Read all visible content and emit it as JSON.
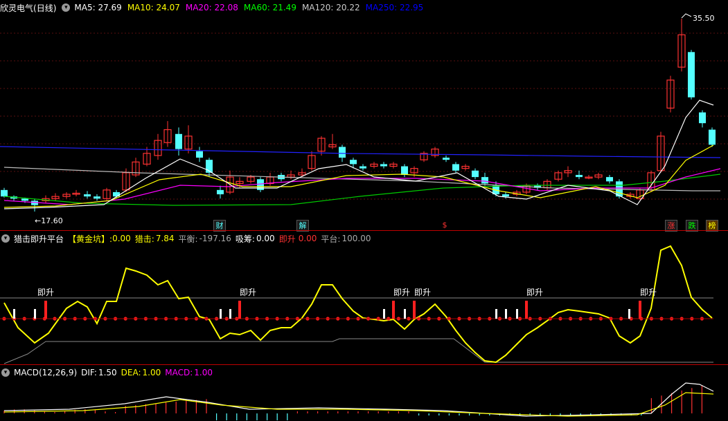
{
  "main_chart": {
    "stock_name": "欣灵电气",
    "period": "(日线)",
    "ma_legend": [
      {
        "label": "MA5:",
        "value": "27.69",
        "color": "#ffffff"
      },
      {
        "label": "MA10:",
        "value": "24.07",
        "color": "#ffff00"
      },
      {
        "label": "MA20:",
        "value": "22.08",
        "color": "#ff00ff"
      },
      {
        "label": "MA60:",
        "value": "21.49",
        "color": "#00ff00"
      },
      {
        "label": "MA120:",
        "value": "20.22",
        "color": "#cccccc"
      },
      {
        "label": "MA250:",
        "value": "22.95",
        "color": "#0000ff"
      }
    ],
    "high_label": "35.50",
    "low_label": "17.60",
    "event_marks": [
      "财",
      "解",
      "$",
      "涨",
      "跌",
      "榜"
    ]
  },
  "indicator_panel": {
    "name": "猎击即升平台",
    "gold_pit_label": "【黄金坑】:",
    "gold_pit_value": "0.00",
    "hunt_label": "猎击:",
    "hunt_value": "7.84",
    "balance_label": "平衡:",
    "balance_value": "-197.16",
    "absorb_label": "吸筹:",
    "absorb_value": "0.00",
    "rise_label": "即升",
    "rise_value": "0.00",
    "platform_label": "平台:",
    "platform_value": "100.00",
    "signal_text": "即升"
  },
  "macd_panel": {
    "name": "MACD(12,26,9)",
    "dif_label": "DIF:",
    "dif_value": "1.50",
    "dea_label": "DEA:",
    "dea_value": "1.00",
    "macd_label": "MACD:",
    "macd_value": "1.00"
  },
  "colors": {
    "up": "#ff3232",
    "down": "#54ffff",
    "background": "#000000",
    "separator": "#c00000"
  }
}
